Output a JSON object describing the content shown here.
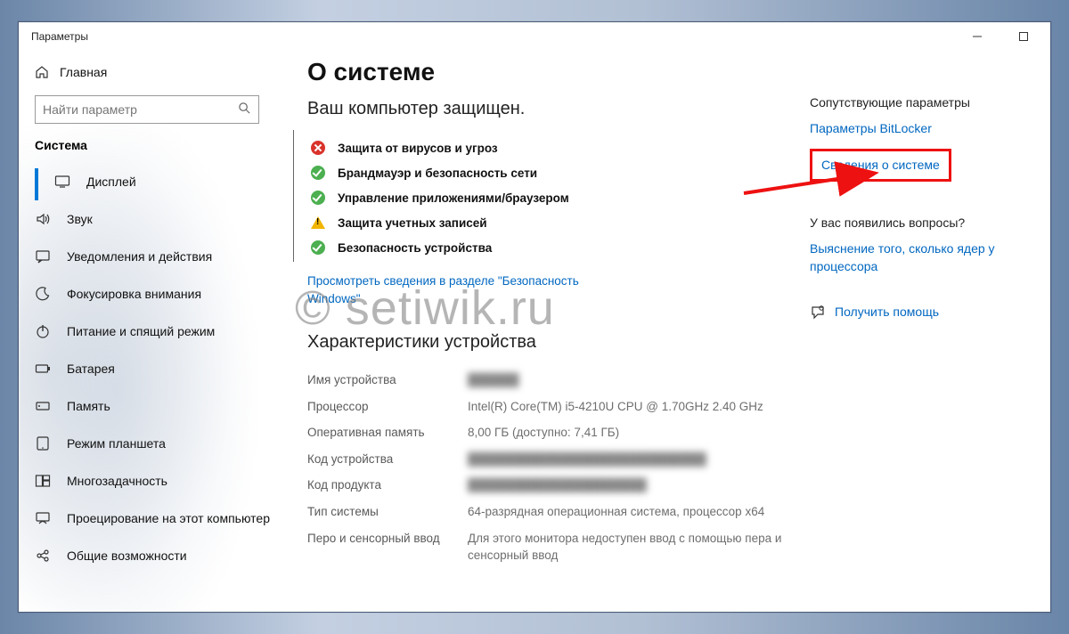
{
  "window": {
    "title": "Параметры"
  },
  "sidebar": {
    "home": "Главная",
    "search_placeholder": "Найти параметр",
    "section": "Система",
    "items": [
      {
        "label": "Дисплей"
      },
      {
        "label": "Звук"
      },
      {
        "label": "Уведомления и действия"
      },
      {
        "label": "Фокусировка внимания"
      },
      {
        "label": "Питание и спящий режим"
      },
      {
        "label": "Батарея"
      },
      {
        "label": "Память"
      },
      {
        "label": "Режим планшета"
      },
      {
        "label": "Многозадачность"
      },
      {
        "label": "Проецирование на этот компьютер"
      },
      {
        "label": "Общие возможности"
      }
    ]
  },
  "main": {
    "title": "О системе",
    "protection_head": "Ваш компьютер защищен.",
    "security": [
      {
        "status": "error",
        "label": "Защита от вирусов и угроз"
      },
      {
        "status": "ok",
        "label": "Брандмауэр и безопасность сети"
      },
      {
        "status": "ok",
        "label": "Управление приложениями/браузером"
      },
      {
        "status": "warn",
        "label": "Защита учетных записей"
      },
      {
        "status": "ok",
        "label": "Безопасность устройства"
      }
    ],
    "security_link": "Просмотреть сведения в разделе \"Безопасность Windows\"",
    "specs_head": "Характеристики устройства",
    "specs": {
      "device_name_label": "Имя устройства",
      "device_name_value": "██████",
      "cpu_label": "Процессор",
      "cpu_value": "Intel(R) Core(TM) i5-4210U CPU @ 1.70GHz 2.40 GHz",
      "ram_label": "Оперативная память",
      "ram_value": "8,00 ГБ (доступно: 7,41 ГБ)",
      "device_id_label": "Код устройства",
      "device_id_value": "████████████████████████████",
      "product_id_label": "Код продукта",
      "product_id_value": "█████████████████████",
      "system_type_label": "Тип системы",
      "system_type_value": "64-разрядная операционная система, процессор x64",
      "pen_label": "Перо и сенсорный ввод",
      "pen_value": "Для этого монитора недоступен ввод с помощью пера и сенсорный ввод"
    }
  },
  "right": {
    "related_head": "Сопутствующие параметры",
    "bitlocker": "Параметры BitLocker",
    "system_info": "Сведения о системе",
    "questions_head": "У вас появились вопросы?",
    "cores": "Выяснение того, сколько ядер у процессора",
    "get_help": "Получить помощь"
  },
  "watermark": "© setiwik.ru"
}
